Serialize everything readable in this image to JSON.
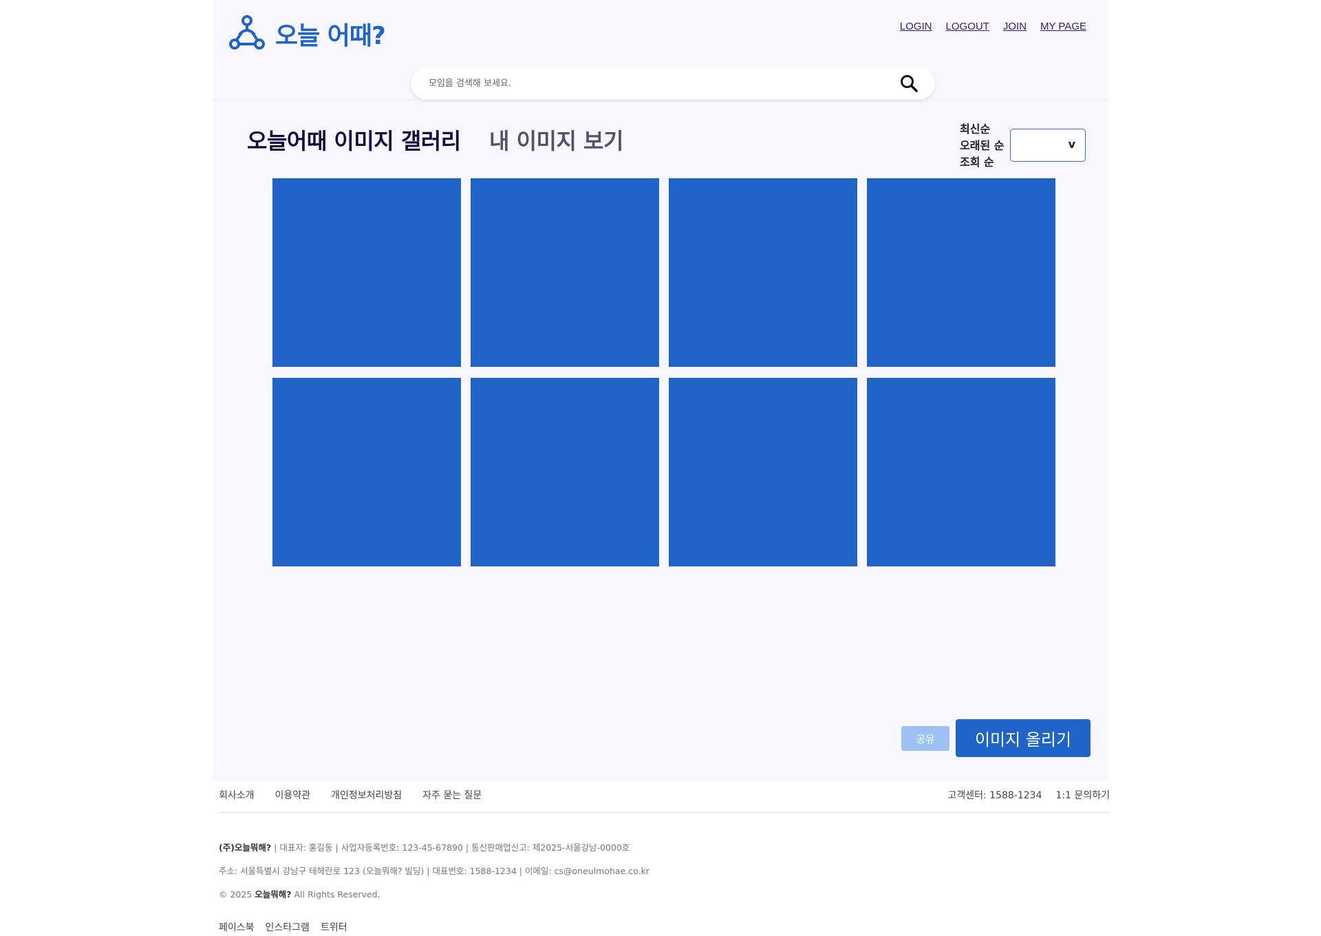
{
  "brand": {
    "logo_text": "오늘 어때?"
  },
  "nav": {
    "login": "LOGIN",
    "logout": "LOGOUT",
    "join": "JOIN",
    "mypage": "MY PAGE"
  },
  "search": {
    "placeholder": "모임을 검색해 보세요."
  },
  "gallery_header": {
    "title": "오늘어때 이미지 갤러리",
    "my_images": "내 이미지 보기",
    "sort_options": [
      "최신순",
      "오래된 순",
      "조회 순"
    ],
    "sort_select_value": "",
    "sort_chevron": "v"
  },
  "gallery": {
    "tile_count": 8,
    "tile_color": "#2064c8"
  },
  "actions": {
    "share": "공유",
    "upload": "이미지 올리기"
  },
  "footer": {
    "links": [
      "회사소개",
      "이용약관",
      "개인정보처리방침",
      "자주 묻는 질문"
    ],
    "customer_center": "고객센터: 1588-1234",
    "inquiry": "1:1 문의하기",
    "company_name": "(주)오늘뭐해?",
    "company_info": " | 대표자: 홍길동 | 사업자등록번호: 123-45-67890 | 통신판매업신고: 제2025-서울강남-0000호",
    "address": "주소: 서울특별시 강남구 테헤란로 123 (오늘뭐해? 빌딩) | 대표번호: 1588-1234 | 이메일: cs@oneulmohae.co.kr",
    "copyright_prefix": "© 2025 ",
    "copyright_brand": "오늘뭐해?",
    "copyright_suffix": " All Rights Reserved.",
    "sns": [
      "페이스북",
      "인스타그램",
      "트위터"
    ]
  },
  "colors": {
    "accent": "#1f64c8",
    "page_bg": "#f7f7fd",
    "share_bg": "#9cc1f4",
    "nav_link": "#3a1a7a"
  }
}
